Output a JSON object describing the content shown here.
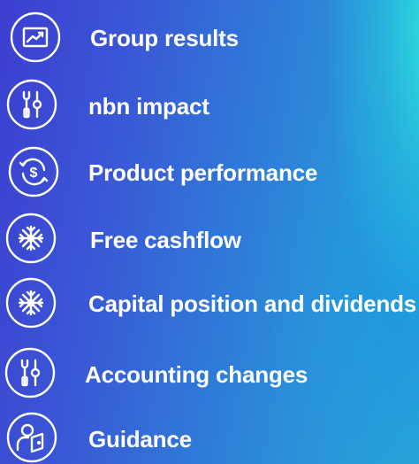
{
  "menu": {
    "items": [
      {
        "label": "Group results",
        "icon": "chart-trend-icon"
      },
      {
        "label": "nbn impact",
        "icon": "tools-icon"
      },
      {
        "label": "Product performance",
        "icon": "dollar-cycle-icon"
      },
      {
        "label": "Free cashflow",
        "icon": "snowflake-icon"
      },
      {
        "label": "Capital position and dividends",
        "icon": "snowflake-icon"
      },
      {
        "label": "Accounting changes",
        "icon": "tools-icon"
      },
      {
        "label": "Guidance",
        "icon": "user-door-icon"
      }
    ]
  },
  "colors": {
    "text": "#ffffff",
    "icon_stroke": "#ffffff",
    "background_start": "#3c3ed0",
    "background_end": "#2ee0e0"
  }
}
